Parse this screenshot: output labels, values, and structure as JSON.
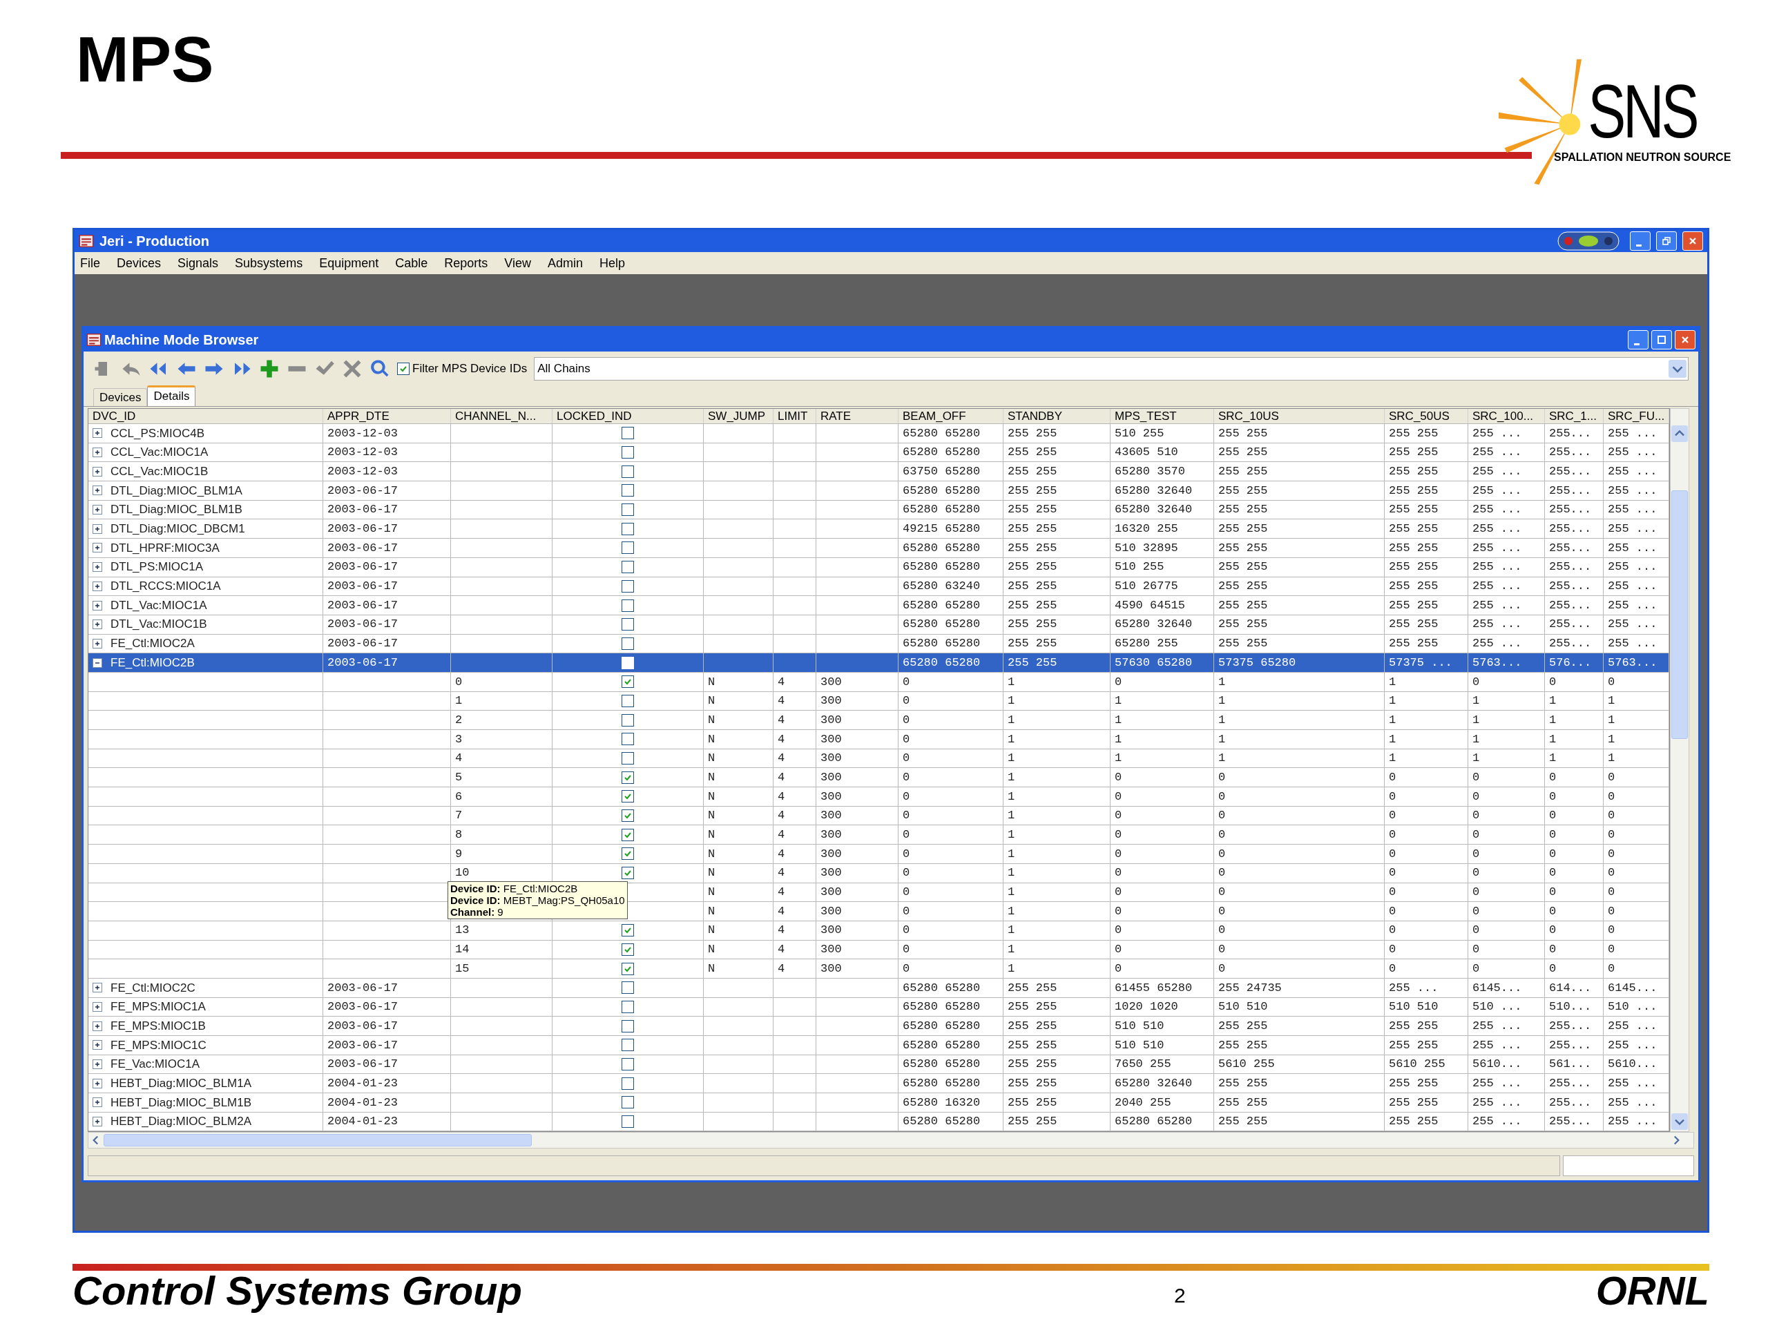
{
  "slide": {
    "title": "MPS",
    "logo": {
      "name": "SNS",
      "subtitle": "SPALLATION NEUTRON SOURCE"
    },
    "footer_left": "Control Systems Group",
    "page_number": "2",
    "footer_right": "ORNL"
  },
  "window": {
    "title": "Jeri - Production",
    "menu": [
      "File",
      "Devices",
      "Signals",
      "Subsystems",
      "Equipment",
      "Cable",
      "Reports",
      "View",
      "Admin",
      "Help"
    ]
  },
  "browser": {
    "title": "Machine Mode Browser",
    "filter": {
      "label": "Filter MPS Device IDs",
      "checked": true
    },
    "chain_select": {
      "value": "All Chains"
    },
    "tabs": [
      {
        "label": "Devices",
        "selected": false
      },
      {
        "label": "Details",
        "selected": true
      }
    ],
    "columns": [
      "DVC_ID",
      "APPR_DTE",
      "CHANNEL_N...",
      "LOCKED_IND",
      "SW_JUMP",
      "LIMIT",
      "RATE",
      "BEAM_OFF",
      "STANDBY",
      "MPS_TEST",
      "SRC_10US",
      "SRC_50US",
      "SRC_100...",
      "SRC_1...",
      "SRC_FU..."
    ],
    "rows": [
      {
        "kind": "device",
        "id": "CCL_PS:MIOC4B",
        "date": "2003-12-03",
        "expanded": false,
        "selected": false,
        "locked": false,
        "values": [
          "65280 65280",
          "255 255",
          "510 255",
          "255 255",
          "255 255",
          "255 ...",
          "255...",
          "255 ..."
        ]
      },
      {
        "kind": "device",
        "id": "CCL_Vac:MIOC1A",
        "date": "2003-12-03",
        "expanded": false,
        "selected": false,
        "locked": false,
        "values": [
          "65280 65280",
          "255 255",
          "43605 510",
          "255 255",
          "255 255",
          "255 ...",
          "255...",
          "255 ..."
        ]
      },
      {
        "kind": "device",
        "id": "CCL_Vac:MIOC1B",
        "date": "2003-12-03",
        "expanded": false,
        "selected": false,
        "locked": false,
        "values": [
          "63750 65280",
          "255 255",
          "65280 3570",
          "255 255",
          "255 255",
          "255 ...",
          "255...",
          "255 ..."
        ]
      },
      {
        "kind": "device",
        "id": "DTL_Diag:MIOC_BLM1A",
        "date": "2003-06-17",
        "expanded": false,
        "selected": false,
        "locked": false,
        "values": [
          "65280 65280",
          "255 255",
          "65280 32640",
          "255 255",
          "255 255",
          "255 ...",
          "255...",
          "255 ..."
        ]
      },
      {
        "kind": "device",
        "id": "DTL_Diag:MIOC_BLM1B",
        "date": "2003-06-17",
        "expanded": false,
        "selected": false,
        "locked": false,
        "values": [
          "65280 65280",
          "255 255",
          "65280 32640",
          "255 255",
          "255 255",
          "255 ...",
          "255...",
          "255 ..."
        ]
      },
      {
        "kind": "device",
        "id": "DTL_Diag:MIOC_DBCM1",
        "date": "2003-06-17",
        "expanded": false,
        "selected": false,
        "locked": false,
        "values": [
          "49215 65280",
          "255 255",
          "16320 255",
          "255 255",
          "255 255",
          "255 ...",
          "255...",
          "255 ..."
        ]
      },
      {
        "kind": "device",
        "id": "DTL_HPRF:MIOC3A",
        "date": "2003-06-17",
        "expanded": false,
        "selected": false,
        "locked": false,
        "values": [
          "65280 65280",
          "255 255",
          "510 32895",
          "255 255",
          "255 255",
          "255 ...",
          "255...",
          "255 ..."
        ]
      },
      {
        "kind": "device",
        "id": "DTL_PS:MIOC1A",
        "date": "2003-06-17",
        "expanded": false,
        "selected": false,
        "locked": false,
        "values": [
          "65280 65280",
          "255 255",
          "510 255",
          "255 255",
          "255 255",
          "255 ...",
          "255...",
          "255 ..."
        ]
      },
      {
        "kind": "device",
        "id": "DTL_RCCS:MIOC1A",
        "date": "2003-06-17",
        "expanded": false,
        "selected": false,
        "locked": false,
        "values": [
          "65280 63240",
          "255 255",
          "510 26775",
          "255 255",
          "255 255",
          "255 ...",
          "255...",
          "255 ..."
        ]
      },
      {
        "kind": "device",
        "id": "DTL_Vac:MIOC1A",
        "date": "2003-06-17",
        "expanded": false,
        "selected": false,
        "locked": false,
        "values": [
          "65280 65280",
          "255 255",
          "4590 64515",
          "255 255",
          "255 255",
          "255 ...",
          "255...",
          "255 ..."
        ]
      },
      {
        "kind": "device",
        "id": "DTL_Vac:MIOC1B",
        "date": "2003-06-17",
        "expanded": false,
        "selected": false,
        "locked": false,
        "values": [
          "65280 65280",
          "255 255",
          "65280 32640",
          "255 255",
          "255 255",
          "255 ...",
          "255...",
          "255 ..."
        ]
      },
      {
        "kind": "device",
        "id": "FE_Ctl:MIOC2A",
        "date": "2003-06-17",
        "expanded": false,
        "selected": false,
        "locked": false,
        "values": [
          "65280 65280",
          "255 255",
          "65280 255",
          "255 255",
          "255 255",
          "255 ...",
          "255...",
          "255 ..."
        ]
      },
      {
        "kind": "device",
        "id": "FE_Ctl:MIOC2B",
        "date": "2003-06-17",
        "expanded": true,
        "selected": true,
        "locked": false,
        "values": [
          "65280 65280",
          "255 255",
          "57630 65280",
          "57375 65280",
          "57375 ...",
          "5763...",
          "576...",
          "5763..."
        ]
      },
      {
        "kind": "channel",
        "channel": "0",
        "locked": true,
        "sw_jump": "N",
        "limit": "4",
        "rate": "300",
        "values": [
          "0",
          "1",
          "0",
          "1",
          "1",
          "0",
          "0",
          "0"
        ]
      },
      {
        "kind": "channel",
        "channel": "1",
        "locked": false,
        "sw_jump": "N",
        "limit": "4",
        "rate": "300",
        "values": [
          "0",
          "1",
          "1",
          "1",
          "1",
          "1",
          "1",
          "1"
        ]
      },
      {
        "kind": "channel",
        "channel": "2",
        "locked": false,
        "sw_jump": "N",
        "limit": "4",
        "rate": "300",
        "values": [
          "0",
          "1",
          "1",
          "1",
          "1",
          "1",
          "1",
          "1"
        ]
      },
      {
        "kind": "channel",
        "channel": "3",
        "locked": false,
        "sw_jump": "N",
        "limit": "4",
        "rate": "300",
        "values": [
          "0",
          "1",
          "1",
          "1",
          "1",
          "1",
          "1",
          "1"
        ]
      },
      {
        "kind": "channel",
        "channel": "4",
        "locked": false,
        "sw_jump": "N",
        "limit": "4",
        "rate": "300",
        "values": [
          "0",
          "1",
          "1",
          "1",
          "1",
          "1",
          "1",
          "1"
        ]
      },
      {
        "kind": "channel",
        "channel": "5",
        "locked": true,
        "sw_jump": "N",
        "limit": "4",
        "rate": "300",
        "values": [
          "0",
          "1",
          "0",
          "0",
          "0",
          "0",
          "0",
          "0"
        ]
      },
      {
        "kind": "channel",
        "channel": "6",
        "locked": true,
        "sw_jump": "N",
        "limit": "4",
        "rate": "300",
        "values": [
          "0",
          "1",
          "0",
          "0",
          "0",
          "0",
          "0",
          "0"
        ]
      },
      {
        "kind": "channel",
        "channel": "7",
        "locked": true,
        "sw_jump": "N",
        "limit": "4",
        "rate": "300",
        "values": [
          "0",
          "1",
          "0",
          "0",
          "0",
          "0",
          "0",
          "0"
        ]
      },
      {
        "kind": "channel",
        "channel": "8",
        "locked": true,
        "sw_jump": "N",
        "limit": "4",
        "rate": "300",
        "values": [
          "0",
          "1",
          "0",
          "0",
          "0",
          "0",
          "0",
          "0"
        ]
      },
      {
        "kind": "channel",
        "channel": "9",
        "locked": true,
        "sw_jump": "N",
        "limit": "4",
        "rate": "300",
        "values": [
          "0",
          "1",
          "0",
          "0",
          "0",
          "0",
          "0",
          "0"
        ]
      },
      {
        "kind": "channel",
        "channel": "10",
        "locked": true,
        "sw_jump": "N",
        "limit": "4",
        "rate": "300",
        "values": [
          "0",
          "1",
          "0",
          "0",
          "0",
          "0",
          "0",
          "0"
        ]
      },
      {
        "kind": "channel",
        "sw_jump": "N",
        "limit": "4",
        "rate": "300",
        "values": [
          "0",
          "1",
          "0",
          "0",
          "0",
          "0",
          "0",
          "0"
        ]
      },
      {
        "kind": "channel",
        "sw_jump": "N",
        "limit": "4",
        "rate": "300",
        "values": [
          "0",
          "1",
          "0",
          "0",
          "0",
          "0",
          "0",
          "0"
        ]
      },
      {
        "kind": "channel",
        "channel": "13",
        "locked": true,
        "sw_jump": "N",
        "limit": "4",
        "rate": "300",
        "values": [
          "0",
          "1",
          "0",
          "0",
          "0",
          "0",
          "0",
          "0"
        ]
      },
      {
        "kind": "channel",
        "channel": "14",
        "locked": true,
        "sw_jump": "N",
        "limit": "4",
        "rate": "300",
        "values": [
          "0",
          "1",
          "0",
          "0",
          "0",
          "0",
          "0",
          "0"
        ]
      },
      {
        "kind": "channel",
        "channel": "15",
        "locked": true,
        "sw_jump": "N",
        "limit": "4",
        "rate": "300",
        "values": [
          "0",
          "1",
          "0",
          "0",
          "0",
          "0",
          "0",
          "0"
        ]
      },
      {
        "kind": "device",
        "id": "FE_Ctl:MIOC2C",
        "date": "2003-06-17",
        "expanded": false,
        "selected": false,
        "locked": false,
        "values": [
          "65280 65280",
          "255 255",
          "61455 65280",
          "255 24735",
          "255 ...",
          "6145...",
          "614...",
          "6145..."
        ]
      },
      {
        "kind": "device",
        "id": "FE_MPS:MIOC1A",
        "date": "2003-06-17",
        "expanded": false,
        "selected": false,
        "locked": false,
        "values": [
          "65280 65280",
          "255 255",
          "1020 1020",
          "510 510",
          "510 510",
          "510 ...",
          "510...",
          "510 ..."
        ]
      },
      {
        "kind": "device",
        "id": "FE_MPS:MIOC1B",
        "date": "2003-06-17",
        "expanded": false,
        "selected": false,
        "locked": false,
        "values": [
          "65280 65280",
          "255 255",
          "510 510",
          "255 255",
          "255 255",
          "255 ...",
          "255...",
          "255 ..."
        ]
      },
      {
        "kind": "device",
        "id": "FE_MPS:MIOC1C",
        "date": "2003-06-17",
        "expanded": false,
        "selected": false,
        "locked": false,
        "values": [
          "65280 65280",
          "255 255",
          "510 510",
          "255 255",
          "255 255",
          "255 ...",
          "255...",
          "255 ..."
        ]
      },
      {
        "kind": "device",
        "id": "FE_Vac:MIOC1A",
        "date": "2003-06-17",
        "expanded": false,
        "selected": false,
        "locked": false,
        "values": [
          "65280 65280",
          "255 255",
          "7650 255",
          "5610 255",
          "5610 255",
          "5610...",
          "561...",
          "5610..."
        ]
      },
      {
        "kind": "device",
        "id": "HEBT_Diag:MIOC_BLM1A",
        "date": "2004-01-23",
        "expanded": false,
        "selected": false,
        "locked": false,
        "values": [
          "65280 65280",
          "255 255",
          "65280 32640",
          "255 255",
          "255 255",
          "255 ...",
          "255...",
          "255 ..."
        ]
      },
      {
        "kind": "device",
        "id": "HEBT_Diag:MIOC_BLM1B",
        "date": "2004-01-23",
        "expanded": false,
        "selected": false,
        "locked": false,
        "values": [
          "65280 16320",
          "255 255",
          "2040 255",
          "255 255",
          "255 255",
          "255 ...",
          "255...",
          "255 ..."
        ]
      },
      {
        "kind": "device",
        "id": "HEBT_Diag:MIOC_BLM2A",
        "date": "2004-01-23",
        "expanded": false,
        "selected": false,
        "locked": false,
        "values": [
          "65280 65280",
          "255 255",
          "65280 65280",
          "255 255",
          "255 255",
          "255 ...",
          "255...",
          "255 ..."
        ]
      }
    ],
    "tooltip": [
      {
        "label": "Device ID:",
        "value": "FE_Ctl:MIOC2B"
      },
      {
        "label": "Device ID:",
        "value": "MEBT_Mag:PS_QH05a10"
      },
      {
        "label": "Channel:",
        "value": "9"
      }
    ]
  }
}
